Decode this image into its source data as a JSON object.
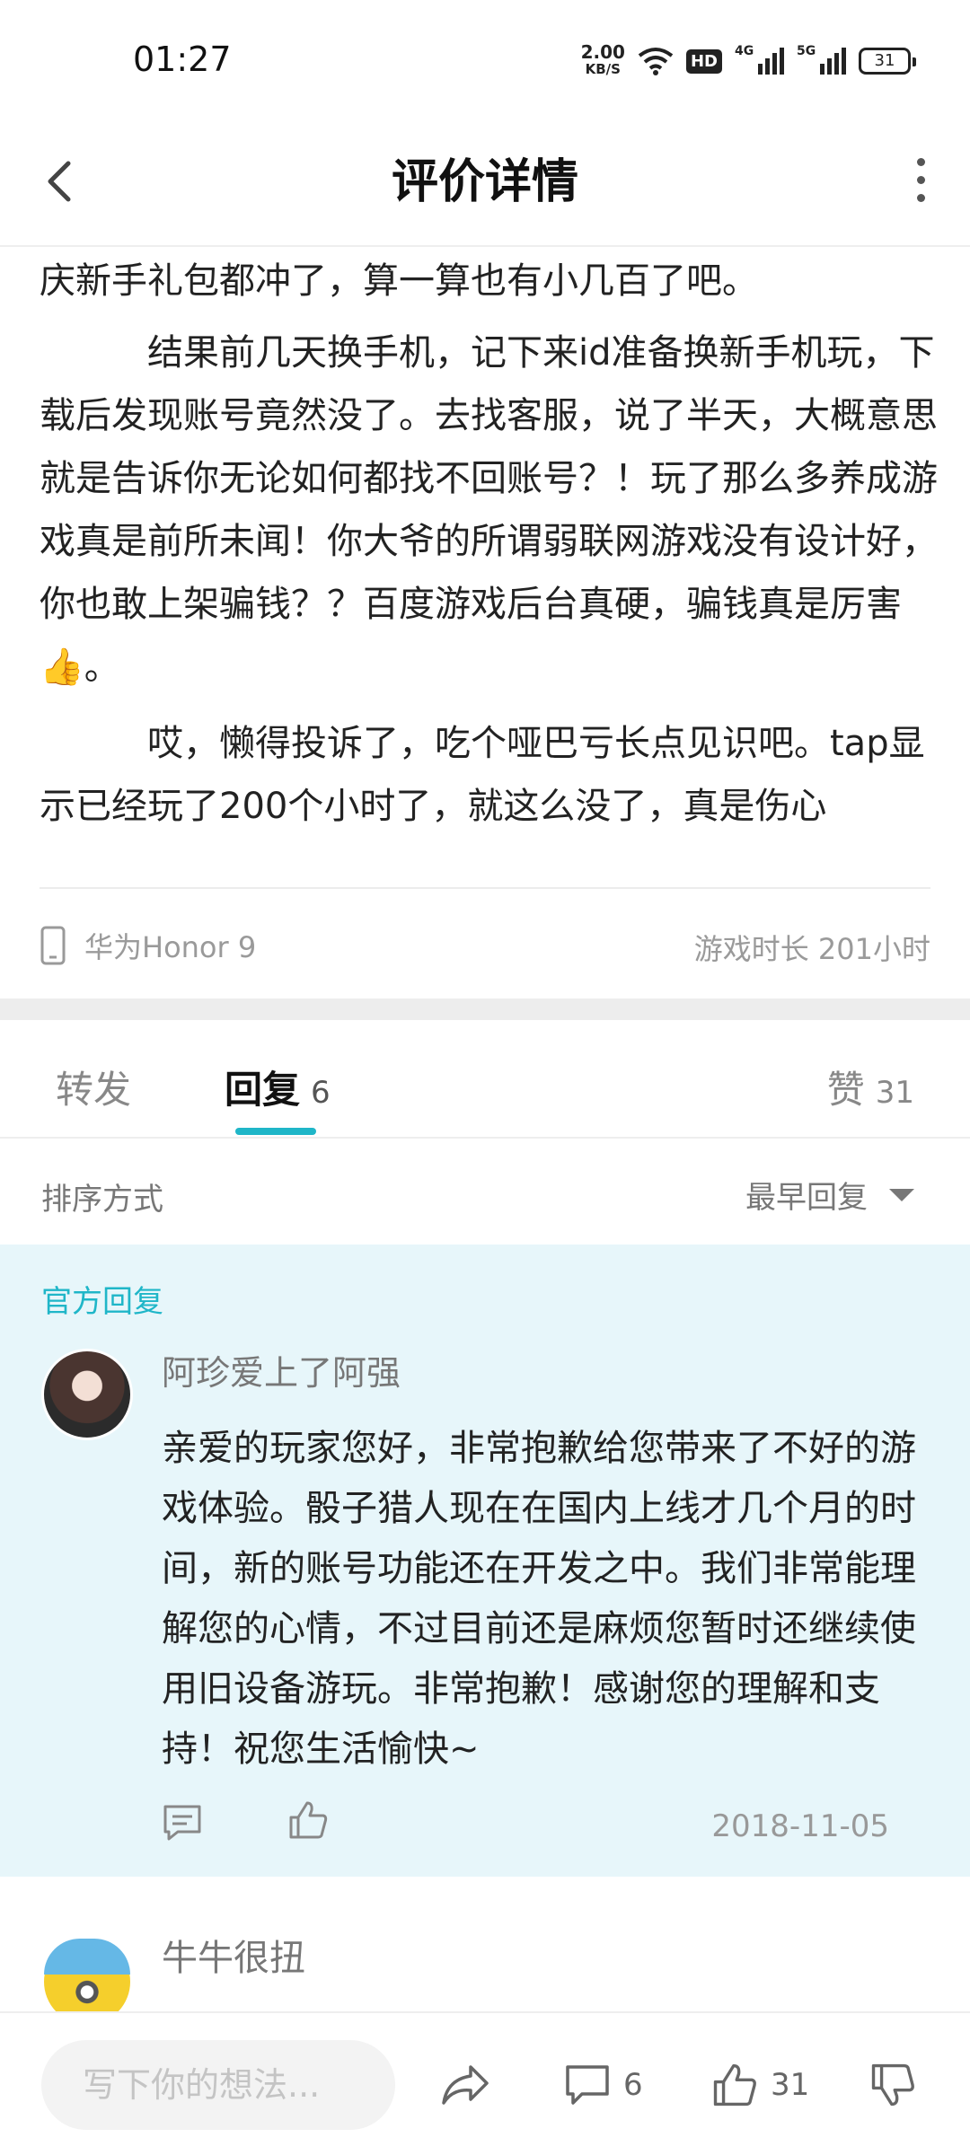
{
  "status_bar": {
    "time": "01:27",
    "net_speed": "2.00",
    "net_speed_unit": "KB/S",
    "hd_label": "HD",
    "signal1_label": "4G",
    "signal2_label": "5G",
    "battery": "31"
  },
  "header": {
    "title": "评价详情"
  },
  "review": {
    "paragraph1": "庆新手礼包都冲了，算一算也有小几百了吧。",
    "paragraph2": "结果前几天换手机，记下来id准备换新手机玩，下载后发现账号竟然没了。去找客服，说了半天，大概意思就是告诉你无论如何都找不回账号？！玩了那么多养成游戏真是前所未闻！你大爷的所谓弱联网游戏没有设计好，你也敢上架骗钱？？百度游戏后台真硬，骗钱真是厉害👍。",
    "paragraph3": "哎，懒得投诉了，吃个哑巴亏长点见识吧。tap显示已经玩了200个小时了，就这么没了，真是伤心",
    "device": "华为Honor 9",
    "play_time": "游戏时长 201小时"
  },
  "tabs": {
    "forward_label": "转发",
    "reply_label": "回复",
    "reply_count": "6",
    "like_label": "赞",
    "like_count": "31"
  },
  "sort": {
    "label": "排序方式",
    "value": "最早回复"
  },
  "official_reply": {
    "section_label": "官方回复",
    "user": "阿珍爱上了阿强",
    "text": "亲爱的玩家您好，非常抱歉给您带来了不好的游戏体验。骰子猎人现在在国内上线才几个月的时间，新的账号功能还在开发之中。我们非常能理解您的心情，不过目前还是麻烦您暂时还继续使用旧设备游玩。非常抱歉！感谢您的理解和支持！祝您生活愉快~",
    "date": "2018-11-05"
  },
  "reply2": {
    "user": "牛牛很扭"
  },
  "bottom_bar": {
    "input_placeholder": "写下你的想法...",
    "comment_count": "6",
    "like_count": "31"
  },
  "colors": {
    "accent": "#1fb6c8",
    "official_bg": "#e7f6fa"
  }
}
